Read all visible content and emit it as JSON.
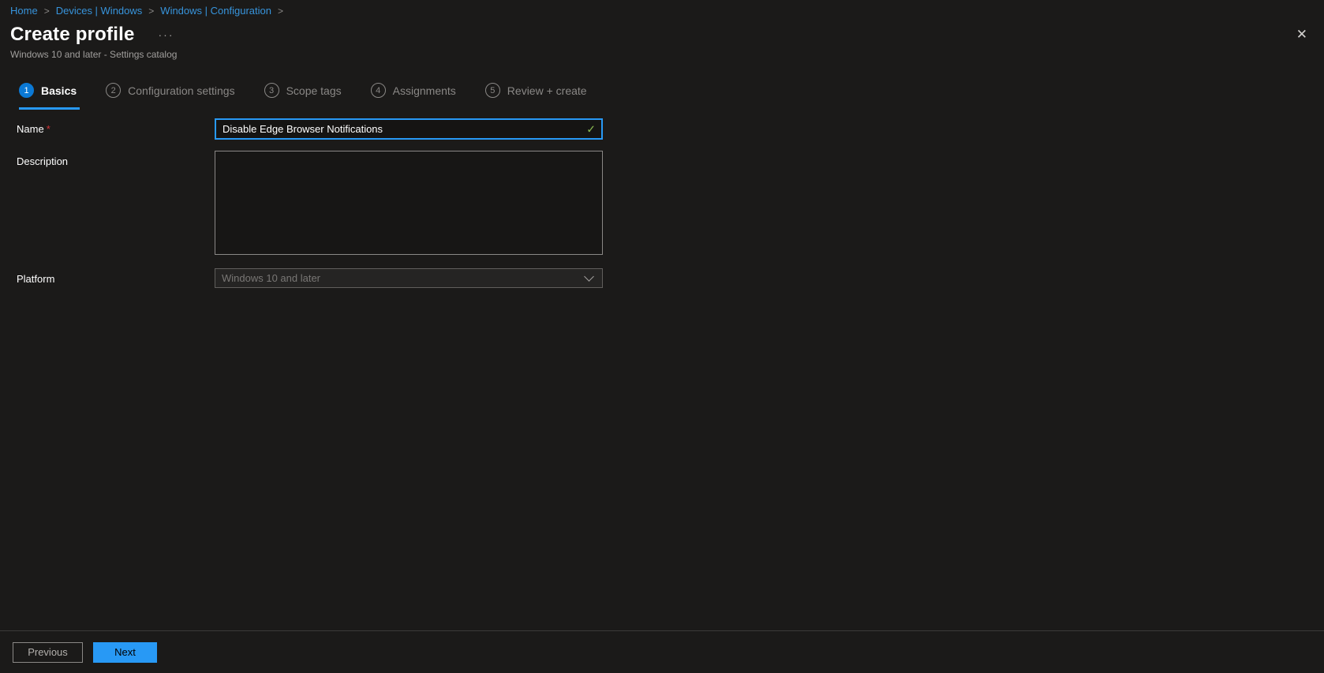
{
  "breadcrumb": {
    "separator": ">",
    "items": [
      {
        "label": "Home"
      },
      {
        "label": "Devices | Windows"
      },
      {
        "label": "Windows | Configuration"
      }
    ]
  },
  "header": {
    "title": "Create profile",
    "subtitle": "Windows 10 and later - Settings catalog",
    "icons": {
      "more": "···",
      "close": "✕"
    }
  },
  "steps": [
    {
      "number": "1",
      "label": "Basics",
      "state": "active"
    },
    {
      "number": "2",
      "label": "Configuration settings",
      "state": "upcoming"
    },
    {
      "number": "3",
      "label": "Scope tags",
      "state": "upcoming"
    },
    {
      "number": "4",
      "label": "Assignments",
      "state": "upcoming"
    },
    {
      "number": "5",
      "label": "Review + create",
      "state": "upcoming"
    }
  ],
  "form": {
    "name": {
      "label": "Name",
      "required_marker": "*",
      "value": "Disable Edge Browser Notifications",
      "valid_icon": "✓"
    },
    "description": {
      "label": "Description",
      "value": ""
    },
    "platform": {
      "label": "Platform",
      "value": "Windows 10 and later"
    }
  },
  "footer": {
    "previous_label": "Previous",
    "next_label": "Next"
  },
  "colors": {
    "background": "#1b1a19",
    "accent_blue": "#2899f5",
    "link_blue": "#3794dc",
    "step_active_blue": "#0b79d5",
    "valid_green": "#8aba52",
    "required_red": "#d13438",
    "muted_text": "#a19f9d"
  }
}
